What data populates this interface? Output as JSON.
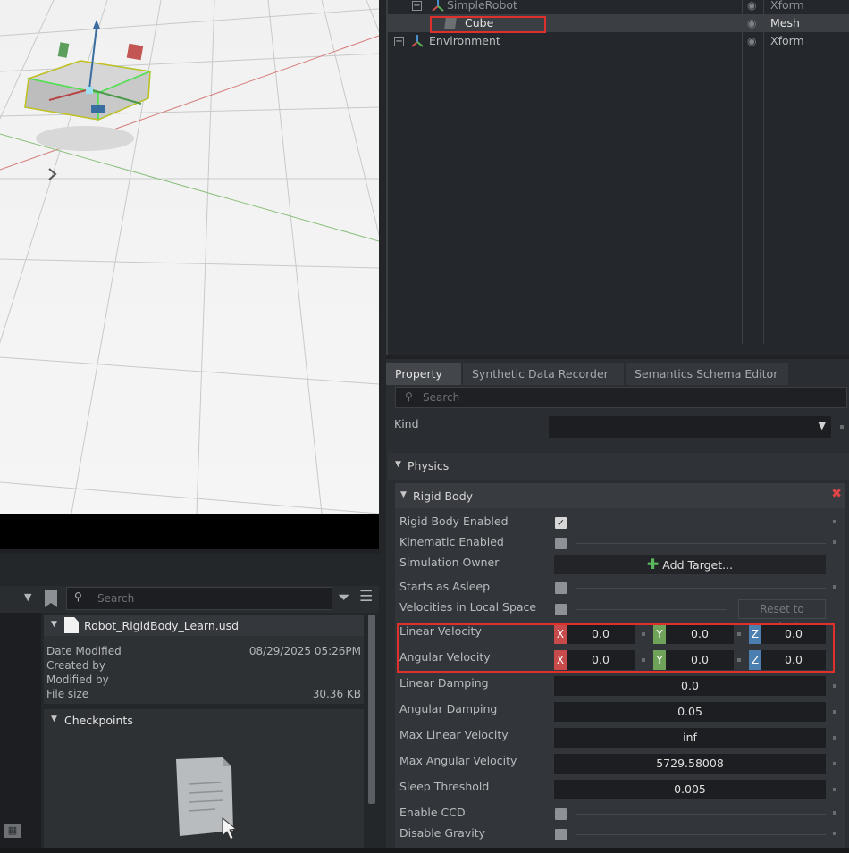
{
  "stage": {
    "rows": [
      {
        "name": "SimpleRobot",
        "type": "Xform",
        "expand": "−"
      },
      {
        "name": "Cube",
        "type": "Mesh"
      },
      {
        "name": "Environment",
        "type": "Xform",
        "expand": "+"
      }
    ]
  },
  "property": {
    "tabs": [
      "Property",
      "Synthetic Data Recorder",
      "Semantics Schema Editor"
    ],
    "search_placeholder": "Search",
    "kind_label": "Kind",
    "physics_label": "Physics",
    "rigid_body_label": "Rigid Body",
    "rows": {
      "rigid_body_enabled": "Rigid Body Enabled",
      "kinematic_enabled": "Kinematic Enabled",
      "simulation_owner": "Simulation Owner",
      "add_target": "Add Target...",
      "starts_asleep": "Starts as Asleep",
      "velocities_local": "Velocities in Local Space",
      "reset_default": "Reset to Default",
      "linear_velocity": "Linear Velocity",
      "angular_velocity": "Angular Velocity",
      "linear_damping": "Linear Damping",
      "angular_damping": "Angular Damping",
      "max_linear_velocity": "Max Linear Velocity",
      "max_angular_velocity": "Max Angular Velocity",
      "sleep_threshold": "Sleep Threshold",
      "enable_ccd": "Enable CCD",
      "disable_gravity": "Disable Gravity"
    },
    "values": {
      "linear_velocity": {
        "x": "0.0",
        "y": "0.0",
        "z": "0.0"
      },
      "angular_velocity": {
        "x": "0.0",
        "y": "0.0",
        "z": "0.0"
      },
      "linear_damping": "0.0",
      "angular_damping": "0.05",
      "max_linear_velocity": "inf",
      "max_angular_velocity": "5729.58008",
      "sleep_threshold": "0.005"
    },
    "axes": {
      "x": "X",
      "y": "Y",
      "z": "Z"
    }
  },
  "content": {
    "search_placeholder": "Search",
    "file_name": "Robot_RigidBody_Learn.usd",
    "date_modified_label": "Date Modified",
    "date_modified_value": "08/29/2025 05:26PM",
    "created_by_label": "Created by",
    "modified_by_label": "Modified by",
    "file_size_label": "File size",
    "file_size_value": "30.36 KB",
    "checkpoints_label": "Checkpoints"
  },
  "colors": {
    "x_axis": "#c74b4b",
    "y_axis": "#6fa35a",
    "z_axis": "#4a7fb0",
    "highlight": "#e0302b"
  }
}
